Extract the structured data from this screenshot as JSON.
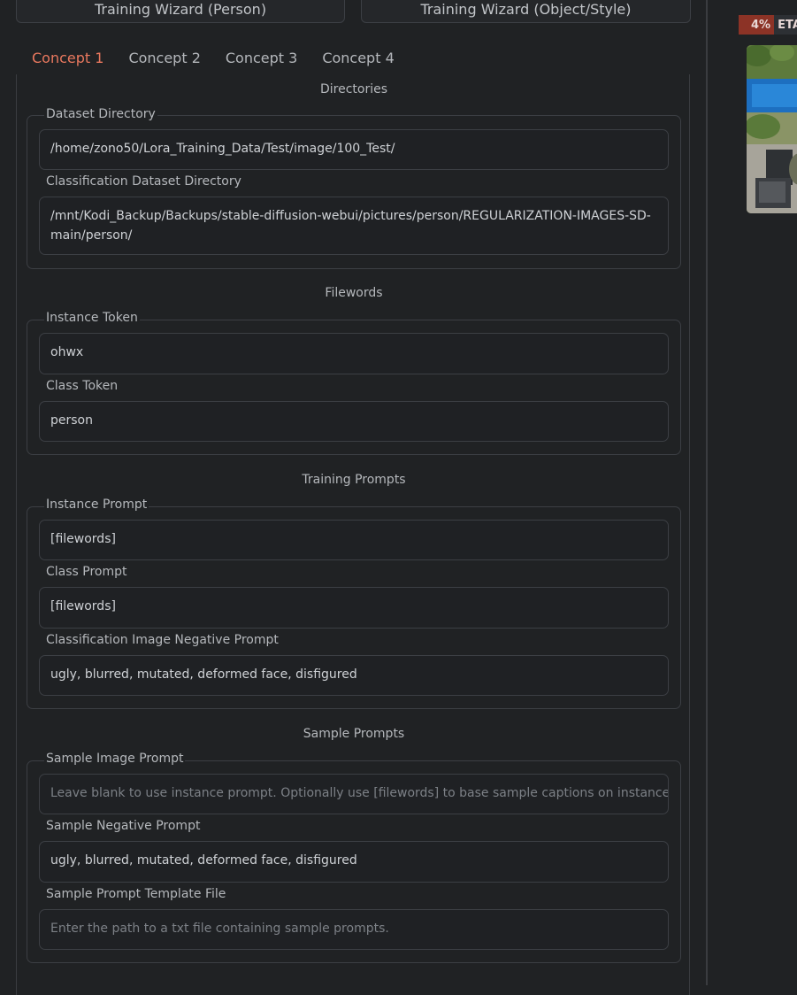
{
  "wizards": {
    "person_label": "Training Wizard (Person)",
    "object_label": "Training Wizard (Object/Style)"
  },
  "tabs": [
    {
      "label": "Concept 1",
      "active": true
    },
    {
      "label": "Concept 2",
      "active": false
    },
    {
      "label": "Concept 3",
      "active": false
    },
    {
      "label": "Concept 4",
      "active": false
    }
  ],
  "sections": {
    "directories": {
      "title": "Directories",
      "dataset_dir": {
        "label": "Dataset Directory",
        "value": "/home/zono50/Lora_Training_Data/Test/image/100_Test/"
      },
      "class_dir": {
        "label": "Classification Dataset Directory",
        "value": "/mnt/Kodi_Backup/Backups/stable-diffusion-webui/pictures/person/REGULARIZATION-IMAGES-SD-main/person/"
      }
    },
    "filewords": {
      "title": "Filewords",
      "instance_token": {
        "label": "Instance Token",
        "value": "ohwx"
      },
      "class_token": {
        "label": "Class Token",
        "value": "person"
      }
    },
    "training_prompts": {
      "title": "Training Prompts",
      "instance_prompt": {
        "label": "Instance Prompt",
        "value": "[filewords]"
      },
      "class_prompt": {
        "label": "Class Prompt",
        "value": "[filewords]"
      },
      "neg_prompt": {
        "label": "Classification Image Negative Prompt",
        "value": "ugly, blurred, mutated, deformed face, disfigured"
      }
    },
    "sample_prompts": {
      "title": "Sample Prompts",
      "sample_image_prompt": {
        "label": "Sample Image Prompt",
        "value": "",
        "placeholder": "Leave blank to use instance prompt. Optionally use [filewords] to base sample captions on instance images."
      },
      "sample_negative_prompt": {
        "label": "Sample Negative Prompt",
        "value": "ugly, blurred, mutated, deformed face, disfigured"
      },
      "sample_template_file": {
        "label": "Sample Prompt Template File",
        "value": "",
        "placeholder": "Enter the path to a txt file containing sample prompts."
      }
    }
  },
  "progress": {
    "percent_label": "4%",
    "eta_label": "ETA:",
    "value": 0.04
  },
  "colors": {
    "accent": "#e9785e",
    "progress_fill": "#8c3326",
    "background": "#202224"
  }
}
